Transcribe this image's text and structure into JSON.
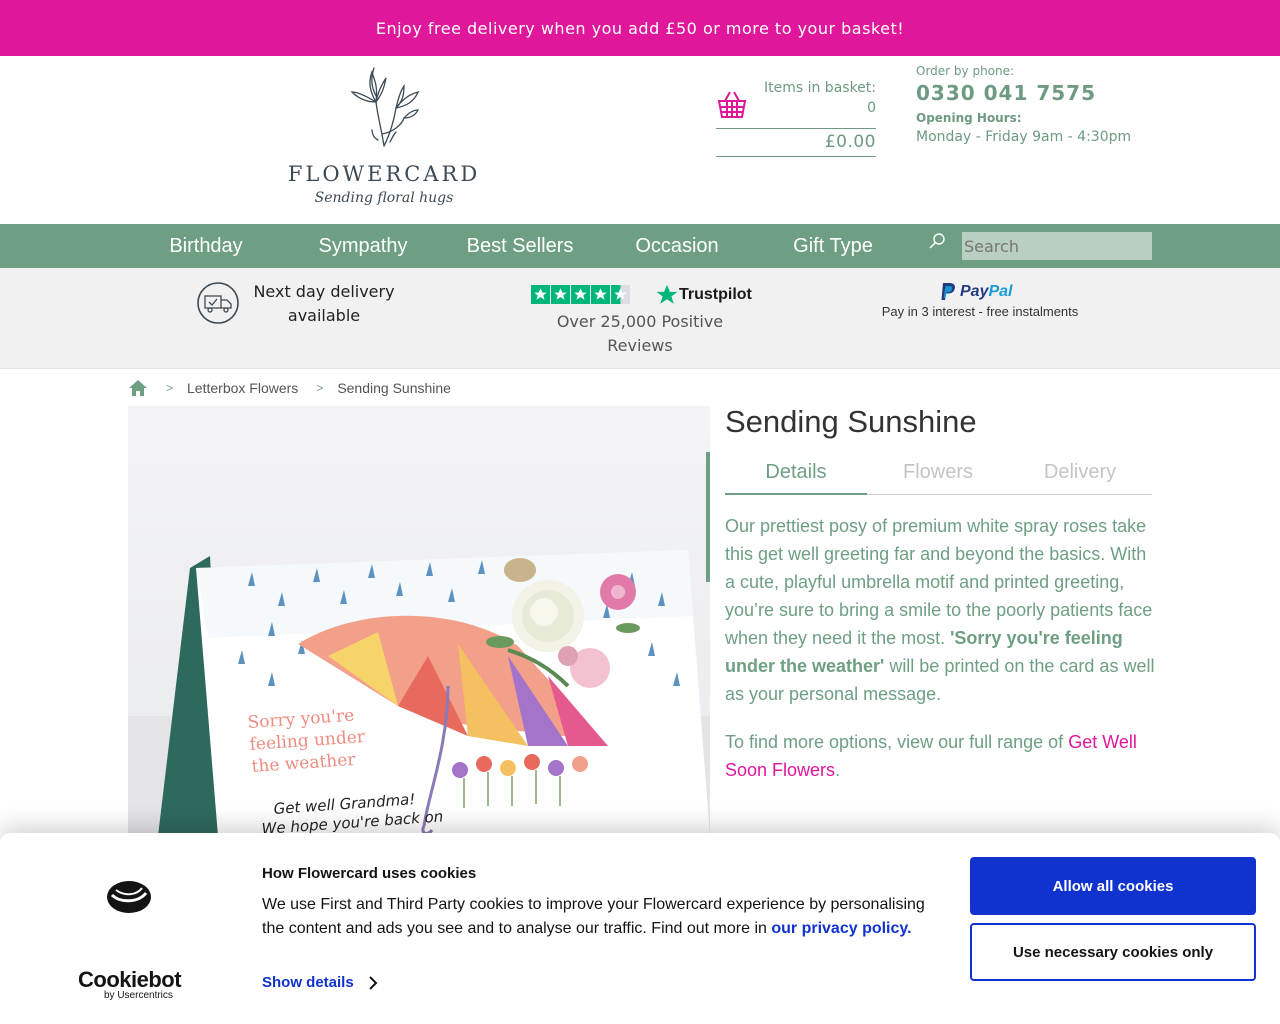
{
  "promo": {
    "text": "Enjoy free delivery when you add £50 or more to your basket!"
  },
  "logo": {
    "name": "FLOWERCARD",
    "tagline": "Sending floral hugs"
  },
  "basket": {
    "label": "Items in basket:",
    "count": "0",
    "total": "£0.00",
    "icon": "basket-icon"
  },
  "contact": {
    "phone_label": "Order by phone:",
    "phone": "0330 041 7575",
    "hours_label": "Opening Hours:",
    "hours": "Monday - Friday 9am - 4:30pm"
  },
  "nav": {
    "items": [
      "Birthday",
      "Sympathy",
      "Best Sellers",
      "Occasion",
      "Gift Type"
    ],
    "search_placeholder": "Search"
  },
  "usp": {
    "delivery": "Next day delivery available",
    "trustpilot_brand": "Trustpilot",
    "trustpilot_rating_stars": 4.5,
    "reviews": "Over 25,000 Positive Reviews",
    "paypal_brand_a": "Pay",
    "paypal_brand_b": "Pal",
    "paypal_text": "Pay in 3 interest - free instalments"
  },
  "breadcrumb": {
    "items": [
      "Letterbox Flowers",
      "Sending Sunshine"
    ]
  },
  "product": {
    "title": "Sending Sunshine",
    "tabs": [
      "Details",
      "Flowers",
      "Delivery"
    ],
    "active_tab": "Details",
    "desc_part1": "Our prettiest posy of premium white spray roses take this get well greeting far and beyond the basics. With a cute, playful umbrella motif and printed greeting, you’re sure to bring a smile to the poorly patients face when they need it the most. ",
    "desc_bold": "'Sorry you're feeling under the weather'",
    "desc_part2": " will be printed on the card as well as your personal message.",
    "more_text": "To find more options, view our full range of ",
    "more_link": "Get Well Soon Flowers",
    "more_end": ".",
    "card_print": [
      "Sorry you're",
      "feeling under",
      "the weather"
    ],
    "card_hand": [
      "Get well Grandma!",
      "We hope you're back on"
    ]
  },
  "cookie": {
    "brand": "Cookiebot",
    "brand_sub": "by Usercentrics",
    "title": "How Flowercard uses cookies",
    "body": "We use First and Third Party cookies to improve your Flowercard experience by personalising the content and ads you see and to analyse our traffic. Find out more in ",
    "link": "our privacy policy.",
    "details": "Show details",
    "allow": "Allow all cookies",
    "necessary": "Use necessary cookies only"
  },
  "colors": {
    "pink": "#e0179a",
    "green": "#6e9f83",
    "blue": "#1032cf"
  }
}
